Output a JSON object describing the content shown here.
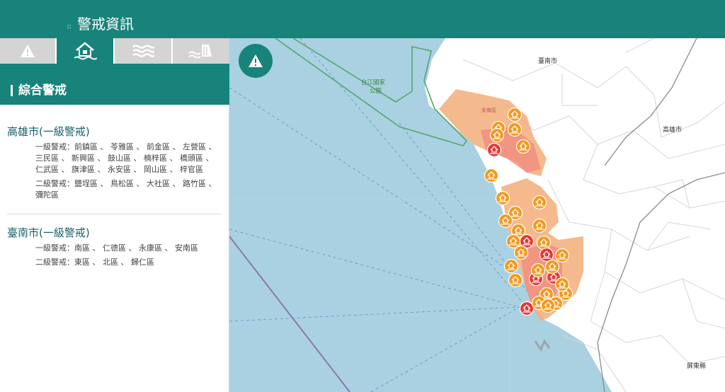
{
  "header": {
    "title": "警戒資訊",
    "grip_icon": "drag-grip-icon"
  },
  "tabs": [
    {
      "name": "warning",
      "icon": "warning-icon",
      "active": false
    },
    {
      "name": "flood",
      "icon": "house-flood-icon",
      "active": true
    },
    {
      "name": "waves",
      "icon": "waves-icon",
      "active": false
    },
    {
      "name": "dam",
      "icon": "dam-icon",
      "active": false
    }
  ],
  "section": {
    "title": "綜合警戒"
  },
  "cities": [
    {
      "name": "高雄市(一級警戒)",
      "level1": "一級警戒：前鎮區 、 苓雅區 、 前金區 、 左營區 、 三民區 、 新興區 、 鼓山區 、 楠梓區 、 橋頭區 、 仁武區 、 旗津區 、 永安區 、 岡山區 、 梓官區",
      "level2": "二級警戒：鹽埕區 、 鳥松區 、 大社區 、 路竹區 、 彌陀區"
    },
    {
      "name": "臺南市(一級警戒)",
      "level1": "一級警戒：南區 、 仁德區 、 永康區 、 安南區",
      "level2": "二級警戒：東區 、 北區 、 歸仁區"
    }
  ],
  "map": {
    "labels": {
      "tainan": "臺南市",
      "kaohsiung": "高雄市",
      "pingtung": "屏東縣",
      "park_line1": "台江國家",
      "park_line2": "公園",
      "annan": "安南區"
    },
    "alert_button_icon": "warning-icon",
    "colors": {
      "sea": "#a9d1e2",
      "land": "#ffffff",
      "district_level1": "#f08a7e",
      "district_level2": "#f3ad7a",
      "marker_red": "#e53935",
      "marker_orange": "#f39a1e",
      "park_boundary": "#55a56a"
    },
    "markers_level1": 8,
    "markers_level2": 24
  }
}
